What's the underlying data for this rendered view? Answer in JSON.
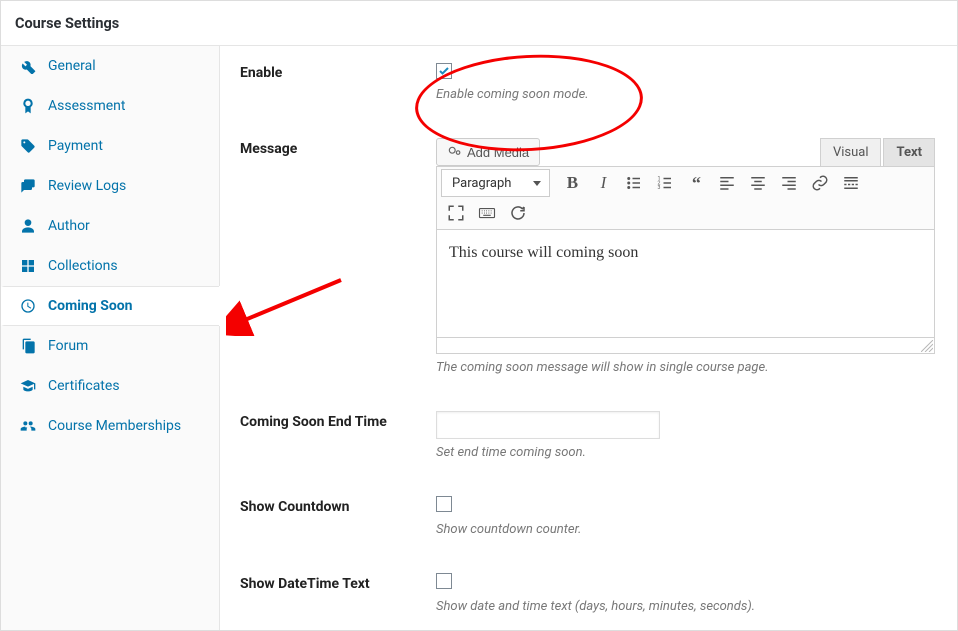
{
  "panel": {
    "title": "Course Settings"
  },
  "sidebar": {
    "items": [
      {
        "label": "General"
      },
      {
        "label": "Assessment"
      },
      {
        "label": "Payment"
      },
      {
        "label": "Review Logs"
      },
      {
        "label": "Author"
      },
      {
        "label": "Collections"
      },
      {
        "label": "Coming Soon",
        "active": true
      },
      {
        "label": "Forum"
      },
      {
        "label": "Certificates"
      },
      {
        "label": "Course Memberships"
      }
    ]
  },
  "rows": {
    "enable": {
      "label": "Enable",
      "checked": true,
      "desc": "Enable coming soon mode."
    },
    "message": {
      "label": "Message",
      "desc": "The coming soon message will show in single course page."
    },
    "end_time": {
      "label": "Coming Soon End Time",
      "value": "",
      "desc": "Set end time coming soon."
    },
    "countdown": {
      "label": "Show Countdown",
      "checked": false,
      "desc": "Show countdown counter."
    },
    "datetime": {
      "label": "Show DateTime Text",
      "checked": false,
      "desc": "Show date and time text (days, hours, minutes, seconds)."
    }
  },
  "editor": {
    "add_media": "Add Media",
    "tabs": {
      "visual": "Visual",
      "text": "Text"
    },
    "format": "Paragraph",
    "content": "This course will coming soon"
  },
  "colors": {
    "accent": "#0373aa",
    "annotation": "#f40000"
  }
}
